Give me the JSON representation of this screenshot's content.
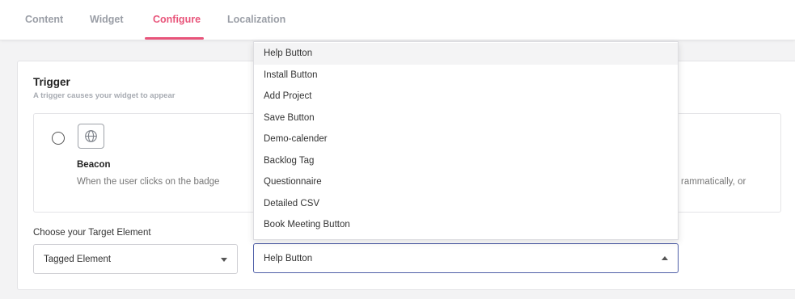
{
  "tabs": [
    {
      "label": "Content"
    },
    {
      "label": "Widget"
    },
    {
      "label": "Configure"
    },
    {
      "label": "Localization"
    }
  ],
  "active_tab": "Configure",
  "accent_color": "#e8547a",
  "trigger": {
    "title": "Trigger",
    "subtitle": "A trigger causes your widget to appear",
    "option": {
      "icon": "globe-icon",
      "title": "Beacon",
      "description": "When the user clicks on the badge",
      "selected": false
    },
    "hidden_option_description_fragment": "rammatically, or"
  },
  "target": {
    "label": "Choose your Target Element",
    "type_select_value": "Tagged Element",
    "element_select_value": "Help Button"
  },
  "dropdown": {
    "open": true,
    "highlighted": "Help Button",
    "items": [
      {
        "label": "Help Button"
      },
      {
        "label": "Install Button"
      },
      {
        "label": "Add Project"
      },
      {
        "label": "Save Button"
      },
      {
        "label": "Demo-calender"
      },
      {
        "label": "Backlog Tag"
      },
      {
        "label": "Questionnaire"
      },
      {
        "label": "Detailed CSV"
      },
      {
        "label": "Book Meeting Button"
      }
    ]
  }
}
